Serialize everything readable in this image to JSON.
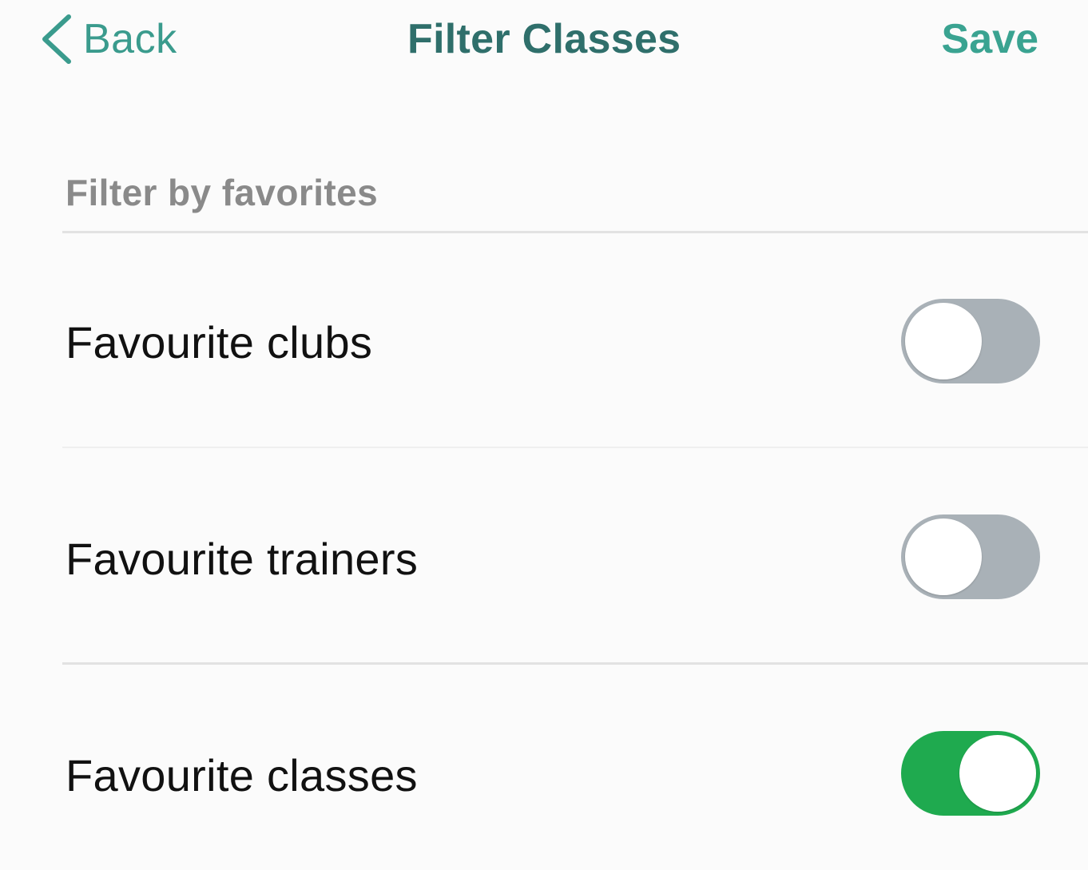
{
  "navbar": {
    "back_label": "Back",
    "title": "Filter Classes",
    "save_label": "Save"
  },
  "section": {
    "header": "Filter by favorites"
  },
  "toggles": [
    {
      "label": "Favourite clubs",
      "state": "off"
    },
    {
      "label": "Favourite trainers",
      "state": "off"
    },
    {
      "label": "Favourite classes",
      "state": "on"
    }
  ],
  "colors": {
    "accent": "#3aa391",
    "title": "#2f6f6b",
    "toggle_on": "#1faa4f",
    "toggle_off": "#a9b1b7"
  },
  "icons": {
    "back": "chevron-left-icon"
  }
}
